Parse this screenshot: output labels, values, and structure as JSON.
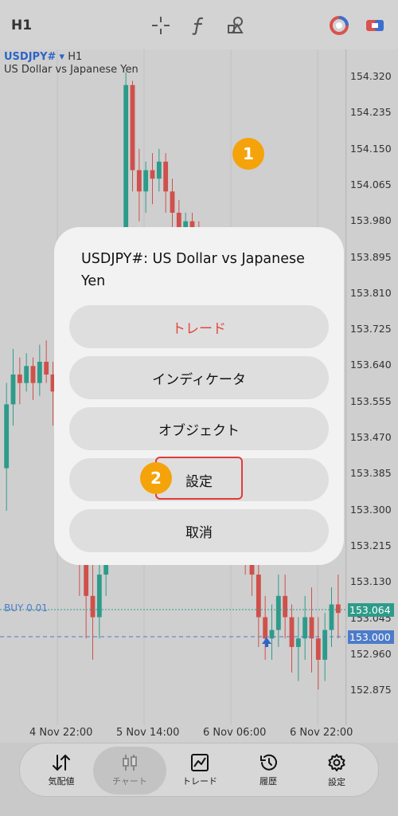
{
  "topbar": {
    "timeframe": "H1",
    "icons": [
      "crosshair-icon",
      "function-icon",
      "objects-icon",
      "account-icon",
      "one-click-trade-icon"
    ]
  },
  "chart": {
    "symbol": "USDJPY#",
    "dropdown_glyph": "▾",
    "timeframe": "H1",
    "symbol_name": "US Dollar vs Japanese Yen",
    "buy_label": "BUY 0.01",
    "price_ticks": [
      "154.320",
      "154.235",
      "154.150",
      "154.065",
      "153.980",
      "153.895",
      "153.810",
      "153.725",
      "153.640",
      "153.555",
      "153.470",
      "153.385",
      "153.300",
      "153.215",
      "153.130",
      "153.045",
      "152.960",
      "152.875"
    ],
    "current_price": "153.064",
    "buy_price": "153.000",
    "time_ticks": [
      "4 Nov 22:00",
      "5 Nov 14:00",
      "6 Nov 06:00",
      "6 Nov 22:00"
    ],
    "colors": {
      "bull": "#2e9b8a",
      "bear": "#d0504b",
      "current": "#2e9b8a",
      "buy": "#4d7bc9"
    }
  },
  "modal": {
    "title": "USDJPY#: US Dollar vs Japanese Yen",
    "buttons": [
      "トレード",
      "インディケータ",
      "オブジェクト",
      "設定",
      "取消"
    ]
  },
  "badges": [
    "1",
    "2"
  ],
  "nav": {
    "items": [
      {
        "label": "気配値",
        "icon": "quotes-icon"
      },
      {
        "label": "チャート",
        "icon": "chart-icon",
        "active": true
      },
      {
        "label": "トレード",
        "icon": "trade-icon"
      },
      {
        "label": "履歴",
        "icon": "history-icon"
      },
      {
        "label": "設定",
        "icon": "settings-icon"
      }
    ]
  }
}
